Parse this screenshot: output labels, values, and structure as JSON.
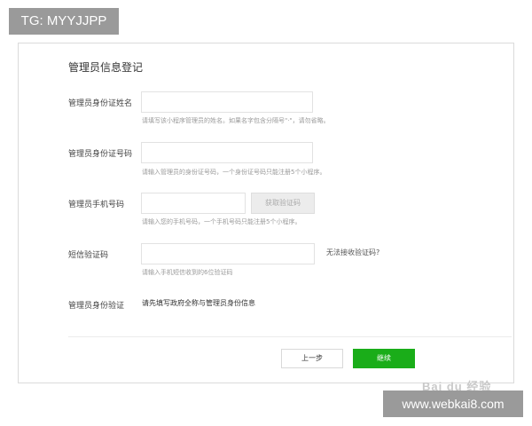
{
  "overlay_tag": "TG: MYYJJPP",
  "form": {
    "title": "管理员信息登记",
    "name": {
      "label": "管理员身份证姓名",
      "value": "",
      "hint": "请填写该小程序管理员的姓名。如果名字包含分隔号\"·\"，请勿省略。"
    },
    "id_number": {
      "label": "管理员身份证号码",
      "value": "",
      "hint": "请输入管理员的身份证号码，一个身份证号码只能注册5个小程序。"
    },
    "phone": {
      "label": "管理员手机号码",
      "value": "",
      "sms_button": "获取验证码",
      "hint": "请输入您的手机号码，一个手机号码只能注册5个小程序。"
    },
    "sms_code": {
      "label": "短信验证码",
      "value": "",
      "help_link": "无法接收验证码?",
      "hint": "请输入手机短信收到的6位验证码"
    },
    "verify": {
      "label": "管理员身份验证",
      "text": "请先填写政府全称与管理员身份信息"
    }
  },
  "footer": {
    "prev_label": "上一步",
    "next_label": "继续"
  },
  "logo_text": "Bai du 经验",
  "watermark": "www.webkai8.com",
  "colors": {
    "primary_button": "#1aad19",
    "overlay_gray": "#9a9a9a"
  }
}
